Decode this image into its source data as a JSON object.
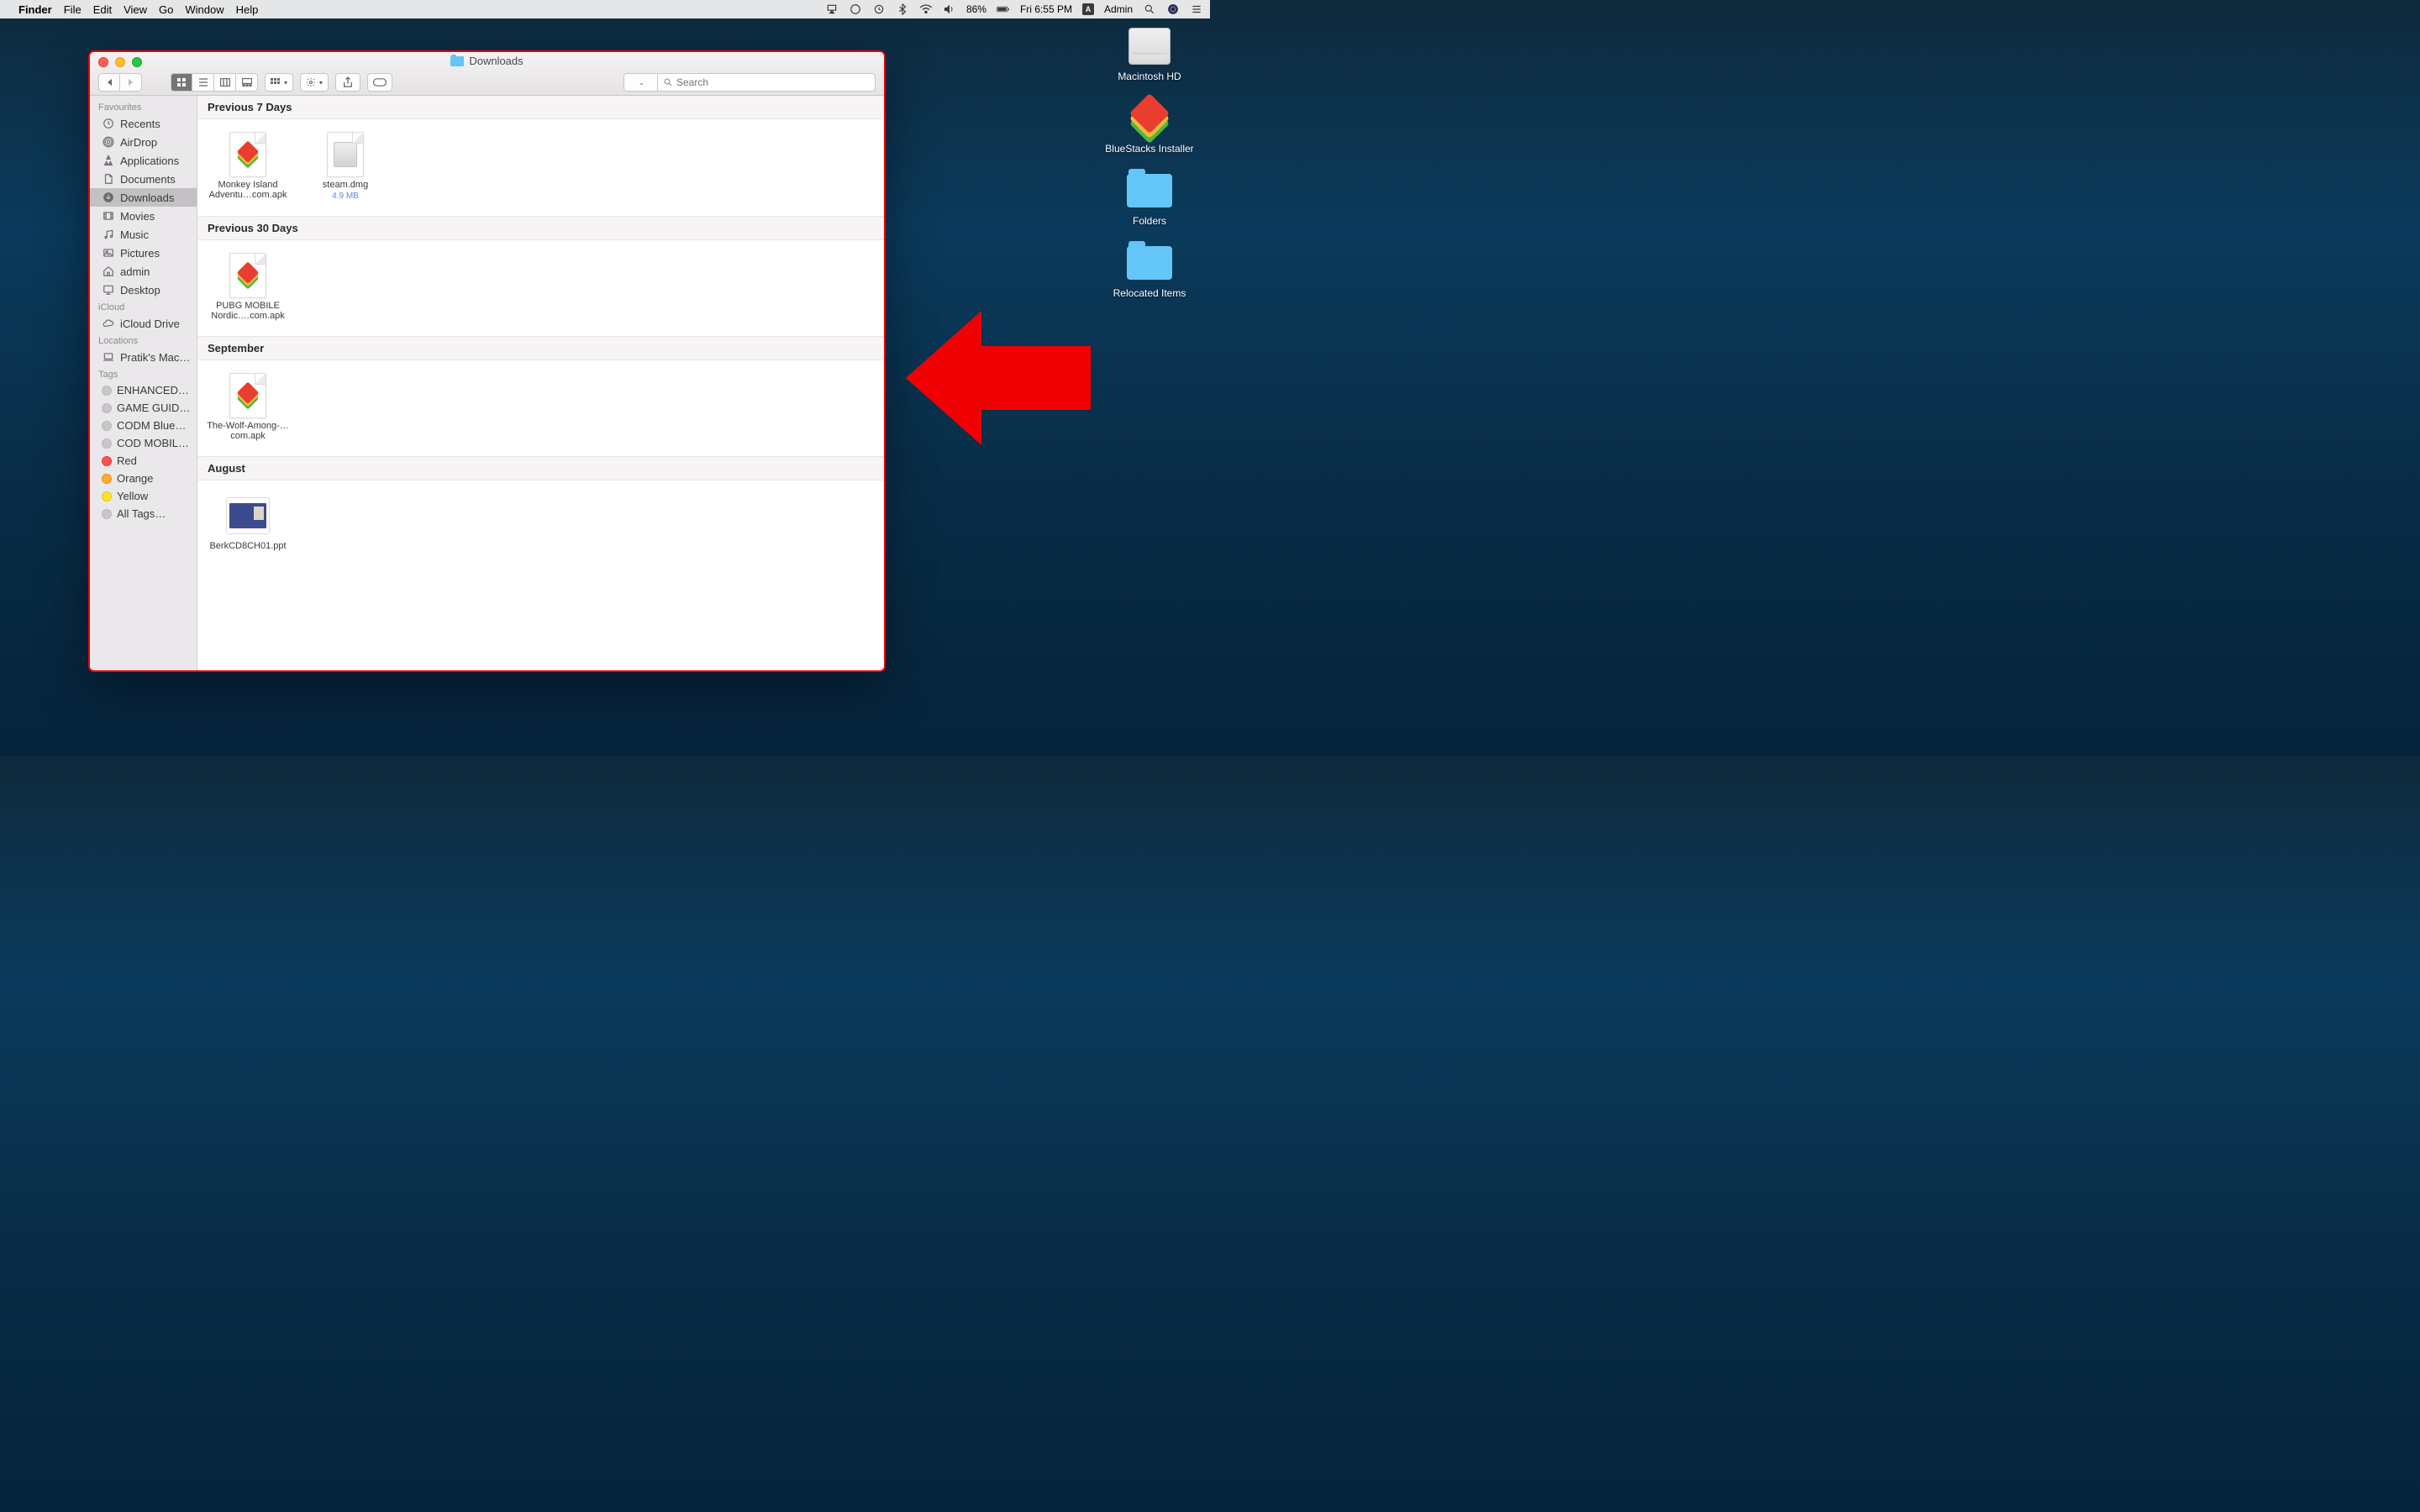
{
  "menubar": {
    "app": "Finder",
    "items": [
      "File",
      "Edit",
      "View",
      "Go",
      "Window",
      "Help"
    ],
    "battery": "86%",
    "clock": "Fri 6:55 PM",
    "user": "Admin"
  },
  "desktop": {
    "items": [
      {
        "kind": "hdd",
        "label": "Macintosh HD"
      },
      {
        "kind": "bluestacks",
        "label": "BlueStacks Installer"
      },
      {
        "kind": "folder",
        "label": "Folders"
      },
      {
        "kind": "folder",
        "label": "Relocated Items"
      }
    ]
  },
  "finder": {
    "title": "Downloads",
    "search_placeholder": "Search",
    "sidebar": {
      "sections": [
        {
          "title": "Favourites",
          "items": [
            {
              "icon": "clock",
              "label": "Recents"
            },
            {
              "icon": "airdrop",
              "label": "AirDrop"
            },
            {
              "icon": "apps",
              "label": "Applications"
            },
            {
              "icon": "doc",
              "label": "Documents"
            },
            {
              "icon": "download",
              "label": "Downloads",
              "selected": true
            },
            {
              "icon": "movie",
              "label": "Movies"
            },
            {
              "icon": "music",
              "label": "Music"
            },
            {
              "icon": "picture",
              "label": "Pictures"
            },
            {
              "icon": "home",
              "label": "admin"
            },
            {
              "icon": "desktop",
              "label": "Desktop"
            }
          ]
        },
        {
          "title": "iCloud",
          "items": [
            {
              "icon": "cloud",
              "label": "iCloud Drive"
            }
          ]
        },
        {
          "title": "Locations",
          "items": [
            {
              "icon": "laptop",
              "label": "Pratik's Mac…"
            }
          ]
        },
        {
          "title": "Tags",
          "items": [
            {
              "tag": "gray",
              "label": "ENHANCED…"
            },
            {
              "tag": "gray",
              "label": "GAME GUID…"
            },
            {
              "tag": "gray",
              "label": "CODM Blue…"
            },
            {
              "tag": "gray",
              "label": "COD MOBIL…"
            },
            {
              "tag": "red",
              "label": "Red"
            },
            {
              "tag": "orange",
              "label": "Orange"
            },
            {
              "tag": "yellow",
              "label": "Yellow"
            },
            {
              "tag": "all",
              "label": "All Tags…"
            }
          ]
        }
      ]
    },
    "groups": [
      {
        "title": "Previous 7 Days",
        "files": [
          {
            "icon": "apk",
            "name": "Monkey Island Adventu…com.apk"
          },
          {
            "icon": "dmg",
            "name": "steam.dmg",
            "size": "4.9 MB"
          }
        ]
      },
      {
        "title": "Previous 30 Days",
        "files": [
          {
            "icon": "apk",
            "name": "PUBG MOBILE Nordic.…com.apk"
          }
        ]
      },
      {
        "title": "September",
        "files": [
          {
            "icon": "apk",
            "name": "The-Wolf-Among-…com.apk"
          }
        ]
      },
      {
        "title": "August",
        "files": [
          {
            "icon": "ppt",
            "name": "BerkCD8CH01.ppt"
          }
        ]
      }
    ]
  }
}
